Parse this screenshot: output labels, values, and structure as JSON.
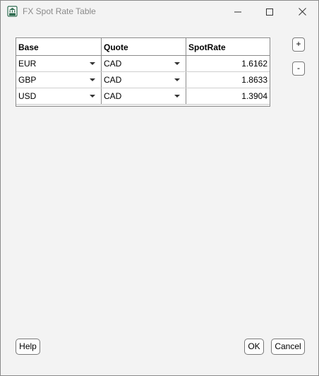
{
  "window": {
    "title": "FX Spot Rate Table",
    "app_icon": "calculator-icon"
  },
  "controls": {
    "minimize_icon": "minimize-icon",
    "maximize_icon": "maximize-icon",
    "close_icon": "close-icon"
  },
  "table": {
    "headers": {
      "base": "Base",
      "quote": "Quote",
      "rate": "SpotRate"
    },
    "rows": [
      {
        "base": "EUR",
        "quote": "CAD",
        "rate": "1.6162"
      },
      {
        "base": "GBP",
        "quote": "CAD",
        "rate": "1.8633"
      },
      {
        "base": "USD",
        "quote": "CAD",
        "rate": "1.3904"
      }
    ]
  },
  "side_buttons": {
    "add_label": "+",
    "remove_label": "-"
  },
  "footer": {
    "help_label": "Help",
    "ok_label": "OK",
    "cancel_label": "Cancel"
  }
}
